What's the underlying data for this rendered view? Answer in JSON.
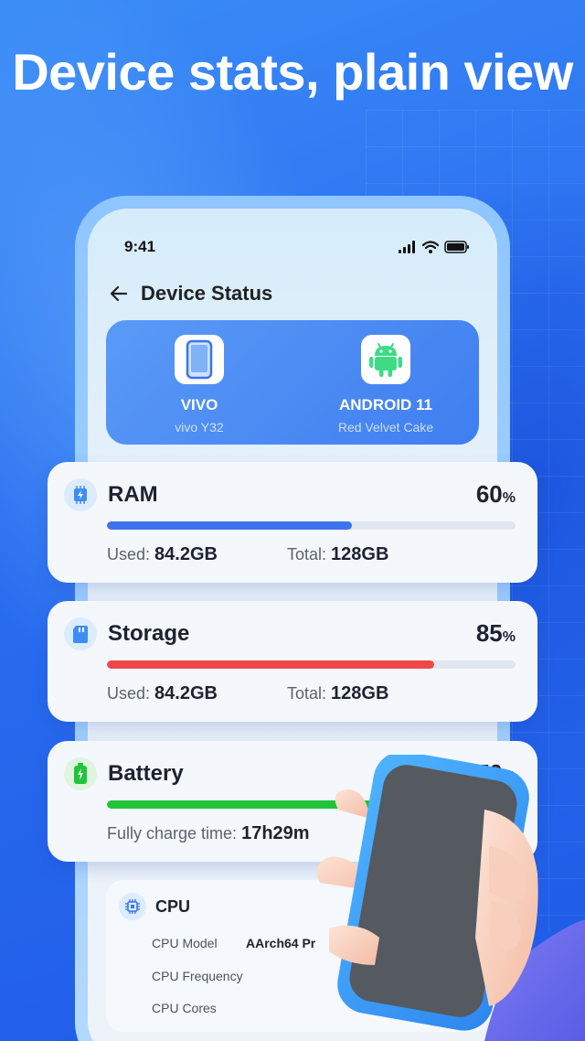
{
  "headline": "Device stats, plain view",
  "status_bar": {
    "time": "9:41"
  },
  "app_bar": {
    "title": "Device Status"
  },
  "device": {
    "phone": {
      "name": "VIVO",
      "model": "vivo Y32"
    },
    "os": {
      "name": "ANDROID 11",
      "codename": "Red Velvet Cake"
    }
  },
  "ram": {
    "title": "RAM",
    "percent": "60",
    "percent_unit": "%",
    "fraction": 0.6,
    "used_label": "Used:",
    "used_value": "84.2GB",
    "total_label": "Total:",
    "total_value": "128GB",
    "color": "#3d73ea"
  },
  "storage": {
    "title": "Storage",
    "percent": "85",
    "percent_unit": "%",
    "fraction": 0.8,
    "used_label": "Used:",
    "used_value": "84.2GB",
    "total_label": "Total:",
    "total_value": "128GB",
    "color": "#f0474a"
  },
  "battery": {
    "title": "Battery",
    "percent": "70",
    "percent_unit": "%",
    "fraction": 0.7,
    "charge_label": "Fully charge time:",
    "charge_value": "17h29m",
    "color": "#1fc43b"
  },
  "cpu": {
    "title": "CPU",
    "model_label": "CPU Model",
    "model_value": "AArch64 Pr",
    "frequency_label": "CPU Frequency",
    "cores_label": "CPU Cores"
  }
}
